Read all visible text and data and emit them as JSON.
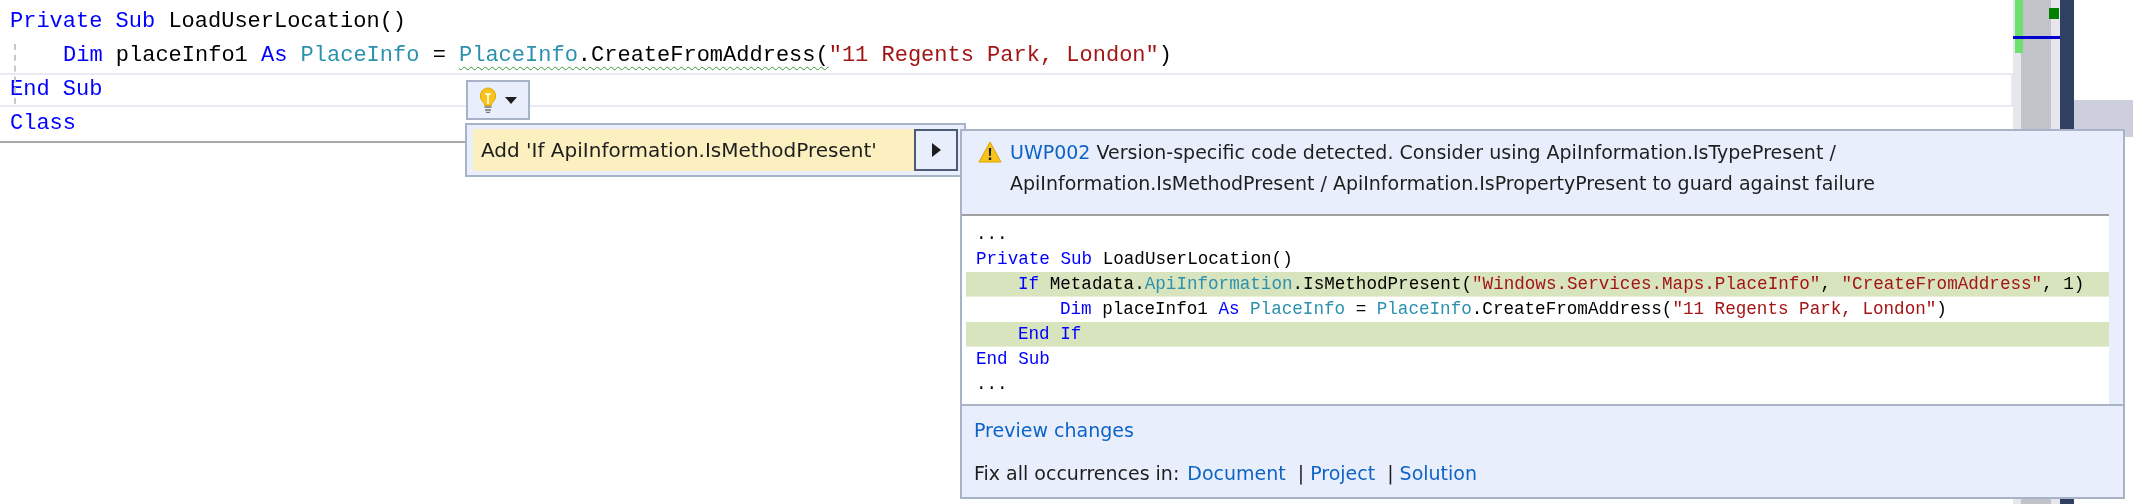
{
  "editor": {
    "lines": [
      {
        "current": false,
        "tokens": [
          {
            "kind": "keyword",
            "text": "Private"
          },
          {
            "kind": "keyword",
            "text": "Sub",
            "gap": true
          },
          {
            "kind": "plain",
            "text": "LoadUserLocation()",
            "gap": true
          }
        ],
        "children": [
          {
            "current": false,
            "tokens": [
              {
                "kind": "keyword",
                "text": "Dim"
              },
              {
                "kind": "plain",
                "text": "placeInfo1",
                "gap": true
              },
              {
                "kind": "keyword",
                "text": "As",
                "gap": true
              },
              {
                "kind": "type",
                "text": "PlaceInfo",
                "gap": true
              },
              {
                "kind": "plain",
                "text": "=",
                "gap": true
              },
              {
                "kind": "type",
                "text": "PlaceInfo",
                "gap": true,
                "squiggle": true
              },
              {
                "kind": "plain",
                "text": ".CreateFromAddress(",
                "squiggle": true
              },
              {
                "kind": "string",
                "text": "\"11 Regents Park, London\""
              },
              {
                "kind": "plain",
                "text": ")"
              }
            ]
          }
        ]
      },
      {
        "current": true,
        "tokens": [
          {
            "kind": "keyword",
            "text": "End"
          },
          {
            "kind": "keyword",
            "text": "Sub",
            "gap": true
          }
        ]
      },
      {
        "current": false,
        "tokens": [
          {
            "kind": "keyword",
            "text": "Class"
          }
        ]
      }
    ]
  },
  "lightbulb_menu": {
    "items": [
      {
        "label": "Add 'If ApiInformation.IsMethodPresent'",
        "selected": true
      }
    ]
  },
  "preview": {
    "code_id": "UWP002",
    "message": "Version-specific code detected. Consider using ApiInformation.IsTypePresent / ApiInformation.IsMethodPresent / ApiInformation.IsPropertyPresent to guard against failure",
    "code_lines": [
      {
        "added": false,
        "tokens": [
          {
            "kind": "plain",
            "text": "..."
          }
        ]
      },
      {
        "added": false,
        "tokens": [
          {
            "kind": "keyword",
            "text": "Private"
          },
          {
            "kind": "keyword",
            "text": "Sub",
            "gap": true
          },
          {
            "kind": "plain",
            "text": "LoadUserLocation()",
            "gap": true
          }
        ],
        "children": [
          {
            "added": true,
            "tokens": [
              {
                "kind": "keyword",
                "text": "If"
              },
              {
                "kind": "plain",
                "text": "Metadata.",
                "gap": true
              },
              {
                "kind": "type",
                "text": "ApiInformation"
              },
              {
                "kind": "plain",
                "text": ".IsMethodPresent("
              },
              {
                "kind": "string",
                "text": "\"Windows.Services.Maps.PlaceInfo\""
              },
              {
                "kind": "plain",
                "text": ","
              },
              {
                "kind": "string",
                "text": "\"CreateFromAddress\"",
                "gap": true
              },
              {
                "kind": "plain",
                "text": ","
              },
              {
                "kind": "plain",
                "text": "1)",
                "gap": true
              }
            ],
            "children": [
              {
                "added": false,
                "tokens": [
                  {
                    "kind": "keyword",
                    "text": "Dim"
                  },
                  {
                    "kind": "plain",
                    "text": "placeInfo1",
                    "gap": true
                  },
                  {
                    "kind": "keyword",
                    "text": "As",
                    "gap": true
                  },
                  {
                    "kind": "type",
                    "text": "PlaceInfo",
                    "gap": true
                  },
                  {
                    "kind": "plain",
                    "text": "=",
                    "gap": true
                  },
                  {
                    "kind": "type",
                    "text": "PlaceInfo",
                    "gap": true
                  },
                  {
                    "kind": "plain",
                    "text": ".CreateFromAddress("
                  },
                  {
                    "kind": "string",
                    "text": "\"11 Regents Park, London\""
                  },
                  {
                    "kind": "plain",
                    "text": ")"
                  }
                ]
              }
            ]
          },
          {
            "added": true,
            "tokens": [
              {
                "kind": "keyword",
                "text": "End"
              },
              {
                "kind": "keyword",
                "text": "If",
                "gap": true
              }
            ]
          }
        ]
      },
      {
        "added": false,
        "tokens": [
          {
            "kind": "keyword",
            "text": "End"
          },
          {
            "kind": "keyword",
            "text": "Sub",
            "gap": true
          }
        ]
      },
      {
        "added": false,
        "tokens": [
          {
            "kind": "plain",
            "text": "..."
          }
        ]
      }
    ],
    "preview_link": "Preview changes",
    "fix_all_label": "Fix all occurrences in:",
    "fix_all_parts": [
      {
        "kind": "link",
        "text": "Document"
      },
      {
        "kind": "separator",
        "text": "|"
      },
      {
        "kind": "link",
        "text": "Project"
      },
      {
        "kind": "separator",
        "text": "|"
      },
      {
        "kind": "link",
        "text": "Solution"
      }
    ]
  }
}
